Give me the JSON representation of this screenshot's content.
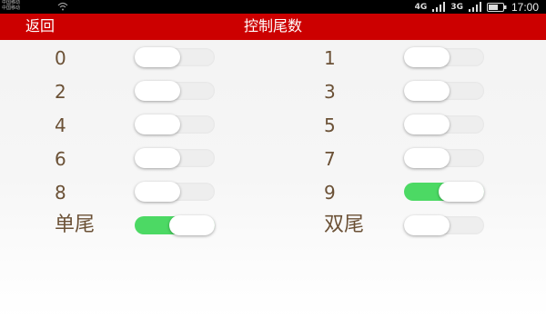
{
  "status_bar": {
    "carrier_lines": [
      "中国移动",
      "中国移动"
    ],
    "network": "4G",
    "network2": "4G",
    "network3": "3G",
    "time": "17:00",
    "icons": [
      "wifi-icon",
      "signal-icon",
      "battery-icon"
    ]
  },
  "nav": {
    "back_label": "返回",
    "title": "控制尾数"
  },
  "colors": {
    "nav_background": "#cc0000",
    "toggle_on": "#4cd964",
    "toggle_off": "#eeeeee",
    "label_text": "#6b5136"
  },
  "digits": [
    {
      "label": "0",
      "on": false
    },
    {
      "label": "1",
      "on": false
    },
    {
      "label": "2",
      "on": false
    },
    {
      "label": "3",
      "on": false
    },
    {
      "label": "4",
      "on": false
    },
    {
      "label": "5",
      "on": false
    },
    {
      "label": "6",
      "on": false
    },
    {
      "label": "7",
      "on": false
    },
    {
      "label": "8",
      "on": false
    },
    {
      "label": "9",
      "on": true
    }
  ],
  "parity": [
    {
      "label": "单尾",
      "on": true
    },
    {
      "label": "双尾",
      "on": false
    }
  ]
}
